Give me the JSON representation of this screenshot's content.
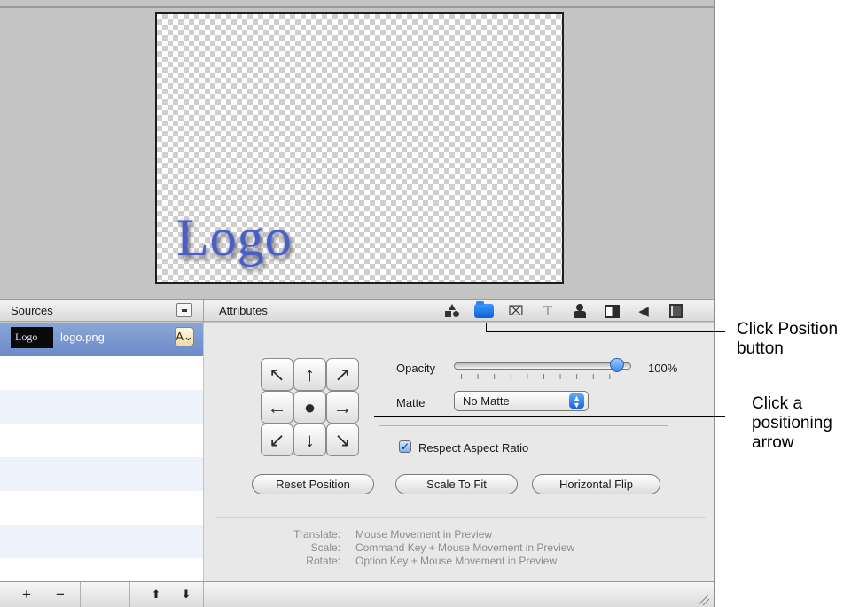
{
  "preview": {
    "logo_text": "Logo"
  },
  "header": {
    "sources_title": "Sources",
    "attributes_title": "Attributes"
  },
  "toolbar": {
    "icons": [
      "shapes-icon",
      "position-icon",
      "crop-icon",
      "text-icon",
      "person-icon",
      "split-icon",
      "audio-icon",
      "film-icon"
    ],
    "active": "position-icon",
    "text_glyph": "T",
    "crop_glyph": "⌧",
    "audio_glyph": "◀"
  },
  "sources": {
    "items": [
      {
        "thumb_text": "Logo",
        "name": "logo.png",
        "badge": "A⌄",
        "selected": true
      }
    ]
  },
  "position": {
    "arrows": [
      "↖",
      "↑",
      "↗",
      "←",
      "●",
      "→",
      "↙",
      "↓",
      "↘"
    ],
    "opacity_label": "Opacity",
    "opacity_value": "100%",
    "opacity_fraction": 1.0,
    "matte_label": "Matte",
    "matte_value": "No Matte",
    "respect_aspect_label": "Respect Aspect Ratio",
    "respect_aspect_checked": true,
    "check_glyph": "✓",
    "buttons": {
      "reset": "Reset Position",
      "scale": "Scale To Fit",
      "flip": "Horizontal Flip"
    }
  },
  "help": {
    "labels": [
      "Translate:",
      "Scale:",
      "Rotate:"
    ],
    "values": [
      "Mouse Movement in Preview",
      "Command Key + Mouse Movement in Preview",
      "Option Key + Mouse Movement in Preview"
    ]
  },
  "bottom_bar": {
    "add": "+",
    "remove": "−",
    "up": "⬆",
    "down": "⬇"
  },
  "callouts": {
    "position_button": "Click Position button",
    "position_button_lines": [
      "Click Position",
      "button"
    ],
    "arrow": "Click a positioning arrow",
    "arrow_lines": [
      "Click a",
      "positioning",
      "arrow"
    ]
  }
}
